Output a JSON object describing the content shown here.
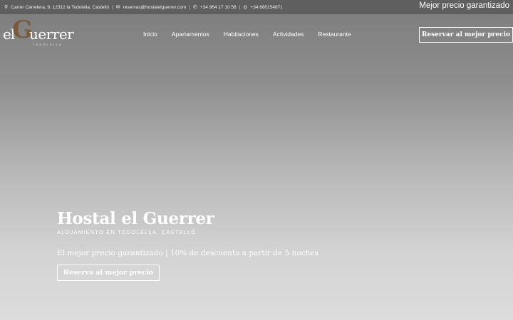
{
  "topbar": {
    "address": "Carrer Carretera, 9, 12312 la Todolella, Castelló",
    "email": "reservas@hostalelguerrer.com",
    "phone": "+34 964 17 10 56",
    "whatsapp": "+34 680154871",
    "separator": "|",
    "promo": "Mejor precio garantizado",
    "icons": {
      "address": "location-pin-icon",
      "email": "envelope-icon",
      "phone": "phone-icon",
      "whatsapp": "whatsapp-icon"
    }
  },
  "logo": {
    "el": "el",
    "g": "G",
    "rest": "uerrer",
    "sub": "TODOLELLA",
    "accent_color": "#7a5a3e"
  },
  "nav": {
    "items": [
      "Inicio",
      "Apartamentos",
      "Habitaciones",
      "Actividades",
      "Restaurante"
    ]
  },
  "header": {
    "reserve_label": "Reservar al mejor precio"
  },
  "hero": {
    "title": "Hostal el Guerrer",
    "subtitle": "ALOJAMIENTO EN TODOLELLA, CASTELLÓ",
    "promo": "El mejor precio garantizado | 10% de descuento a partir de 5 noches",
    "button_label": "Reserva al mejor precio"
  }
}
